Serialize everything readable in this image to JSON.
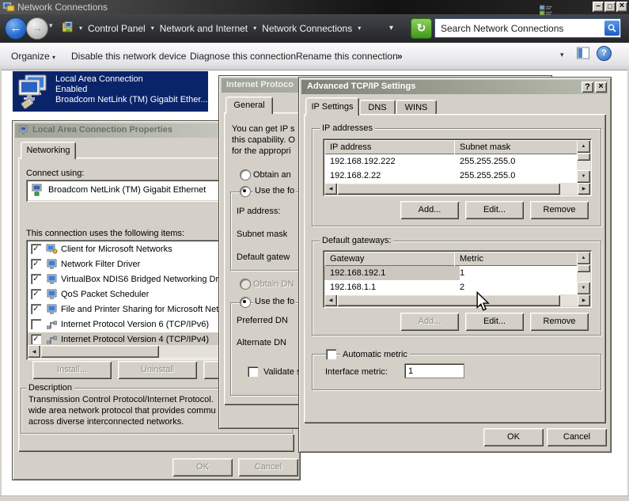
{
  "colors": {
    "selection_blue": "#0a246a",
    "dialog_face": "#d4d0c8",
    "active_title": "#7e8376",
    "refresh_green": "#4f9e1f",
    "search_blue": "#2a6ad4"
  },
  "icons": {
    "check": "✓",
    "arrow_down_small": "▾",
    "back": "←",
    "forward": "→",
    "minimize": "–",
    "maximize": "□",
    "close": "×",
    "help": "?",
    "scroll_up": "▲",
    "scroll_down": "▼",
    "scroll_left": "◀",
    "scroll_right": "▶",
    "refresh": "↻"
  },
  "window": {
    "title": "Network Connections"
  },
  "address_bar": {
    "crumbs": [
      "Control Panel",
      "Network and Internet",
      "Network Connections"
    ],
    "search_text": "Search Network Connections"
  },
  "command_bar": {
    "organize": "Organize",
    "disable": "Disable this network device",
    "diagnose": "Diagnose this connection",
    "rename": "Rename this connection",
    "more": "»"
  },
  "connection_item": {
    "name": "Local Area Connection",
    "status": "Enabled",
    "device": "Broadcom NetLink (TM) Gigabit Ether..."
  },
  "properties_dialog": {
    "title": "Local Area Connection Properties",
    "tab": "Networking",
    "connect_using": "Connect using:",
    "adapter": "Broadcom NetLink (TM) Gigabit Ethernet",
    "items_label": "This connection uses the following items:",
    "items": [
      {
        "label": "Client for Microsoft Networks",
        "checked": true
      },
      {
        "label": "Network Filter Driver",
        "checked": true
      },
      {
        "label": "VirtualBox NDIS6 Bridged Networking Dri",
        "checked": true
      },
      {
        "label": "QoS Packet Scheduler",
        "checked": true
      },
      {
        "label": "File and Printer Sharing for Microsoft Netw",
        "checked": true
      },
      {
        "label": "Internet Protocol Version 6 (TCP/IPv6)",
        "checked": false
      },
      {
        "label": "Internet Protocol Version 4 (TCP/IPv4)",
        "checked": true
      }
    ],
    "install": "Install...",
    "uninstall": "Uninstall",
    "description_label": "Description",
    "description_lines": [
      "Transmission Control Protocol/Internet Protocol.",
      "wide area network protocol that provides commu",
      "across diverse interconnected networks."
    ],
    "ok": "OK",
    "cancel": "Cancel"
  },
  "ip_dialog": {
    "title": "Internet Protoco",
    "tab": "General",
    "intro_lines": [
      "You can get IP s",
      "this capability. O",
      "for the appropri"
    ],
    "obtain_ip": "Obtain an",
    "use_ip": "Use the fo",
    "ip_label": "IP address:",
    "subnet_label": "Subnet mask",
    "gateway_label": "Default gatew",
    "obtain_dns": "Obtain DN",
    "use_dns": "Use the fo",
    "preferred_label": "Preferred DN",
    "alternate_label": "Alternate DN",
    "validate_label": "Validate s"
  },
  "advanced_dialog": {
    "title": "Advanced TCP/IP Settings",
    "tabs": [
      "IP Settings",
      "DNS",
      "WINS"
    ],
    "ip_addresses": {
      "label": "IP addresses",
      "columns": [
        "IP address",
        "Subnet mask"
      ],
      "rows": [
        [
          "192.168.192.222",
          "255.255.255.0"
        ],
        [
          "192.168.2.22",
          "255.255.255.0"
        ]
      ],
      "add": "Add...",
      "edit": "Edit...",
      "remove": "Remove"
    },
    "gateways": {
      "label": "Default gateways:",
      "columns": [
        "Gateway",
        "Metric"
      ],
      "rows": [
        [
          "192.168.192.1",
          "1"
        ],
        [
          "192.168.1.1",
          "2"
        ]
      ],
      "add": "Add...",
      "edit": "Edit...",
      "remove": "Remove"
    },
    "auto_metric": "Automatic metric",
    "interface_metric_label": "Interface metric:",
    "interface_metric_value": "1",
    "ok": "OK",
    "cancel": "Cancel"
  }
}
